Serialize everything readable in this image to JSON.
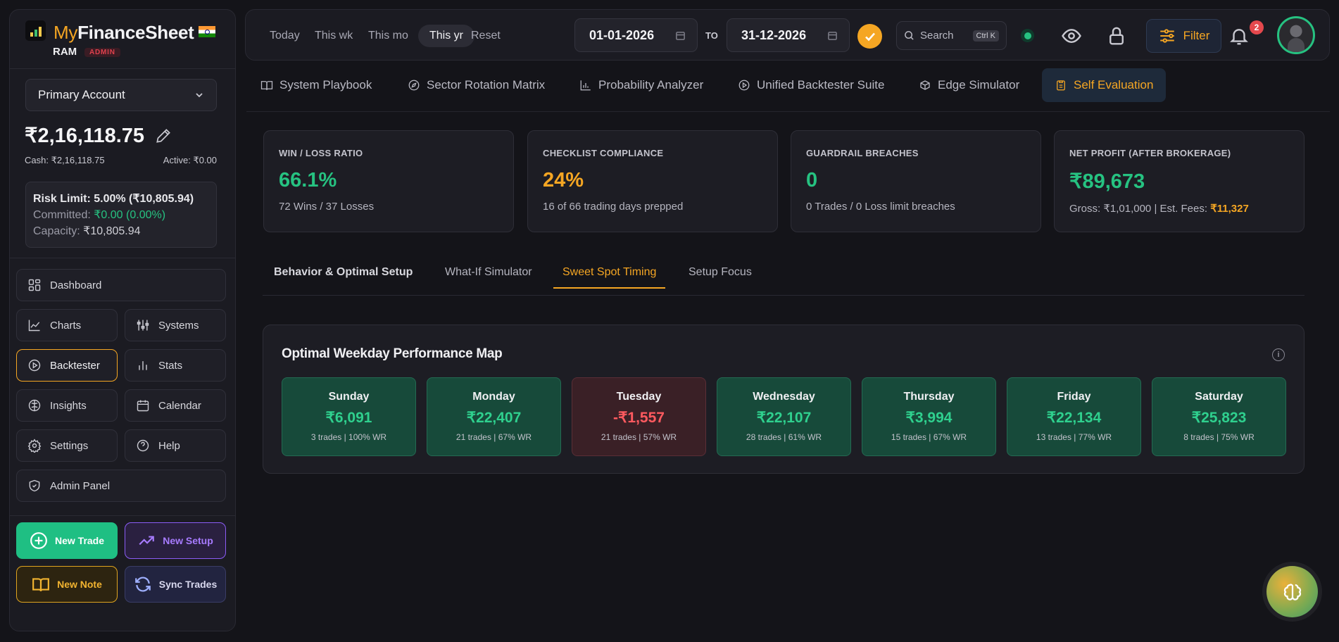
{
  "brand": {
    "my": "My",
    "finance_sheet": "FinanceSheet",
    "user": "RAM",
    "role": "ADMIN"
  },
  "account": {
    "selected": "Primary Account",
    "balance": "₹2,16,118.75",
    "cash": "Cash: ₹2,16,118.75",
    "active": "Active: ₹0.00",
    "risk_limit": "Risk Limit: 5.00% (₹10,805.94)",
    "committed_label": "Committed: ",
    "committed_value": "₹0.00 (0.00%)",
    "capacity_label": "Capacity: ",
    "capacity_value": "₹10,805.94"
  },
  "nav": {
    "dashboard": "Dashboard",
    "charts": "Charts",
    "systems": "Systems",
    "backtester": "Backtester",
    "stats": "Stats",
    "insights": "Insights",
    "calendar": "Calendar",
    "settings": "Settings",
    "help": "Help",
    "admin_panel": "Admin Panel"
  },
  "actions": {
    "new_trade": "New Trade",
    "new_setup": "New Setup",
    "new_note": "New Note",
    "sync_trades": "Sync Trades"
  },
  "topbar": {
    "ranges": [
      "Today",
      "This wk",
      "This mo",
      "This yr",
      "Reset"
    ],
    "selected_range": "This yr",
    "from_date": "01-01-2026",
    "to_label": "TO",
    "to_date": "31-12-2026",
    "search": "Search",
    "shortcut": "Ctrl K",
    "filter": "Filter",
    "notifications": "2"
  },
  "module_tabs": [
    "System Playbook",
    "Sector Rotation Matrix",
    "Probability Analyzer",
    "Unified Backtester Suite",
    "Edge Simulator",
    "Self Evaluation"
  ],
  "selected_module": "Self Evaluation",
  "stats": [
    {
      "title": "WIN / LOSS RATIO",
      "value": "66.1%",
      "sub": "72 Wins / 37 Losses",
      "color": "#26c281"
    },
    {
      "title": "CHECKLIST COMPLIANCE",
      "value": "24%",
      "sub": "16 of 66 trading days prepped",
      "color": "#f5a623"
    },
    {
      "title": "GUARDRAIL BREACHES",
      "value": "0",
      "sub": "0 Trades / 0 Loss limit breaches",
      "color": "#26c281"
    },
    {
      "title": "NET PROFIT (AFTER BROKERAGE)",
      "value": "₹89,673",
      "sub": "Gross: ₹1,01,000 | Est. Fees: ",
      "fee": "₹11,327",
      "color": "#26c281"
    }
  ],
  "sub_tabs": [
    "Behavior & Optimal Setup",
    "What-If Simulator",
    "Sweet Spot Timing",
    "Setup Focus"
  ],
  "selected_sub_tab": "Sweet Spot Timing",
  "weekday_panel": {
    "title": "Optimal Weekday Performance Map",
    "info": "i",
    "days": [
      {
        "name": "Sunday",
        "value": "₹6,091",
        "sub": "3 trades | 100% WR",
        "sign": "pos"
      },
      {
        "name": "Monday",
        "value": "₹22,407",
        "sub": "21 trades | 67% WR",
        "sign": "pos"
      },
      {
        "name": "Tuesday",
        "value": "-₹1,557",
        "sub": "21 trades | 57% WR",
        "sign": "neg"
      },
      {
        "name": "Wednesday",
        "value": "₹22,107",
        "sub": "28 trades | 61% WR",
        "sign": "pos"
      },
      {
        "name": "Thursday",
        "value": "₹3,994",
        "sub": "15 trades | 67% WR",
        "sign": "pos"
      },
      {
        "name": "Friday",
        "value": "₹22,134",
        "sub": "13 trades | 77% WR",
        "sign": "pos"
      },
      {
        "name": "Saturday",
        "value": "₹25,823",
        "sub": "8 trades | 75% WR",
        "sign": "pos"
      }
    ]
  },
  "colors": {
    "accent": "#f5a623",
    "positive": "#26c281",
    "negative": "#ff5a5f",
    "background": "#141419"
  }
}
